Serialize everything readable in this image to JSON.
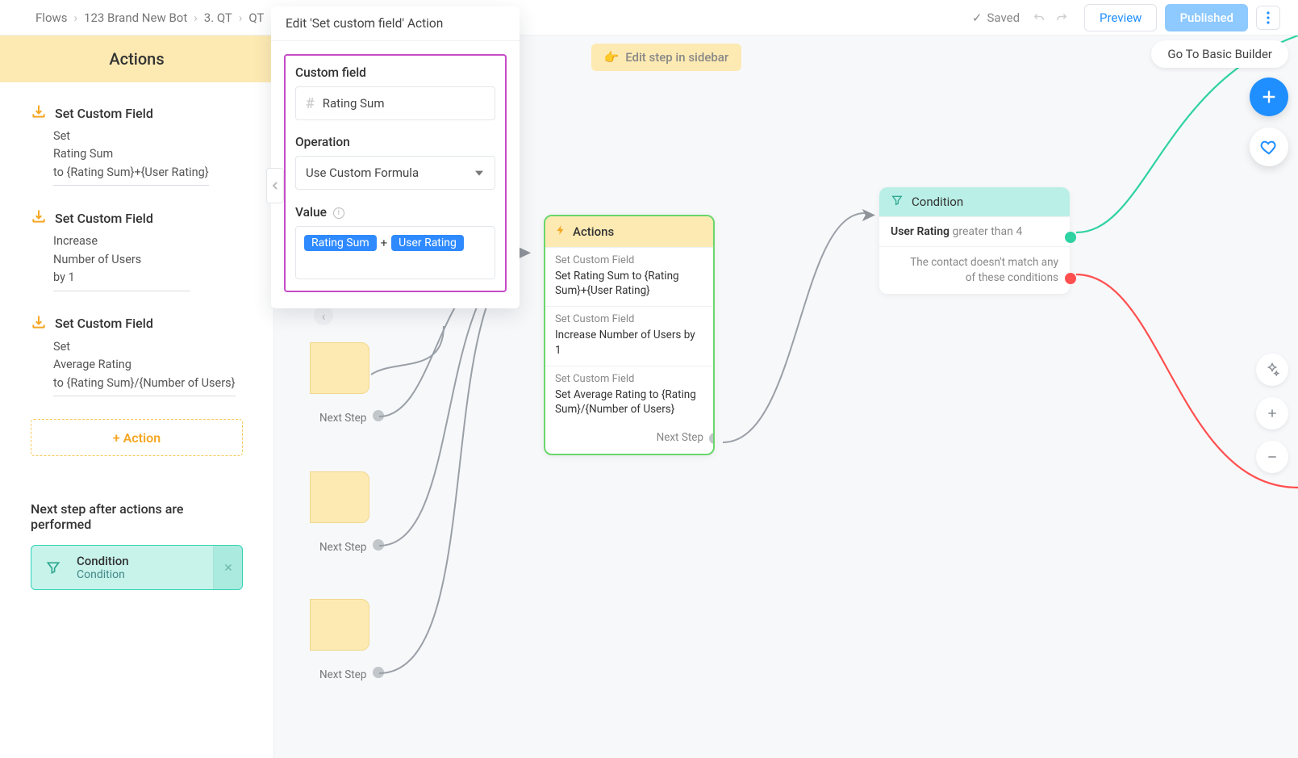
{
  "breadcrumbs": [
    "Flows",
    "123 Brand New Bot",
    "3. QT",
    "QT"
  ],
  "topbar": {
    "saved": "Saved",
    "preview": "Preview",
    "published": "Published"
  },
  "canvas_buttons": {
    "edit_step": "Edit step in sidebar",
    "basic_builder": "Go To Basic Builder"
  },
  "sidebar": {
    "title": "Actions",
    "items": [
      {
        "title": "Set Custom Field",
        "line1": "Set",
        "line2": "Rating Sum",
        "line3": "to {Rating Sum}+{User Rating}"
      },
      {
        "title": "Set Custom Field",
        "line1": "Increase",
        "line2": "Number of Users",
        "line3": "by 1"
      },
      {
        "title": "Set Custom Field",
        "line1": "Set",
        "line2": "Average Rating",
        "line3": "to {Rating Sum}/{Number of Users}"
      }
    ],
    "add_action": "+ Action",
    "next_label": "Next step after actions are performed",
    "condition_chip": {
      "title": "Condition",
      "subtitle": "Condition"
    }
  },
  "edit_panel": {
    "header": "Edit 'Set custom field' Action",
    "custom_field_label": "Custom field",
    "custom_field_value": "Rating Sum",
    "operation_label": "Operation",
    "operation_value": "Use Custom Formula",
    "value_label": "Value",
    "value_tags": [
      "Rating Sum",
      "User Rating"
    ],
    "value_join": "+"
  },
  "actions_card": {
    "header": "Actions",
    "sections": [
      {
        "title": "Set Custom Field",
        "body": "Set Rating Sum to {Rating Sum}+{User Rating}"
      },
      {
        "title": "Set Custom Field",
        "body": "Increase Number of Users by 1"
      },
      {
        "title": "Set Custom Field",
        "body": "Set Average Rating to {Rating Sum}/{Number of Users}"
      }
    ],
    "footer": "Next Step"
  },
  "condition_card": {
    "header": "Condition",
    "rule_field": "User Rating",
    "rule_op": "greater than",
    "rule_val": "4",
    "else_line1": "The contact doesn't match any",
    "else_line2": "of these conditions"
  },
  "labels": {
    "next_step": "Next Step"
  }
}
